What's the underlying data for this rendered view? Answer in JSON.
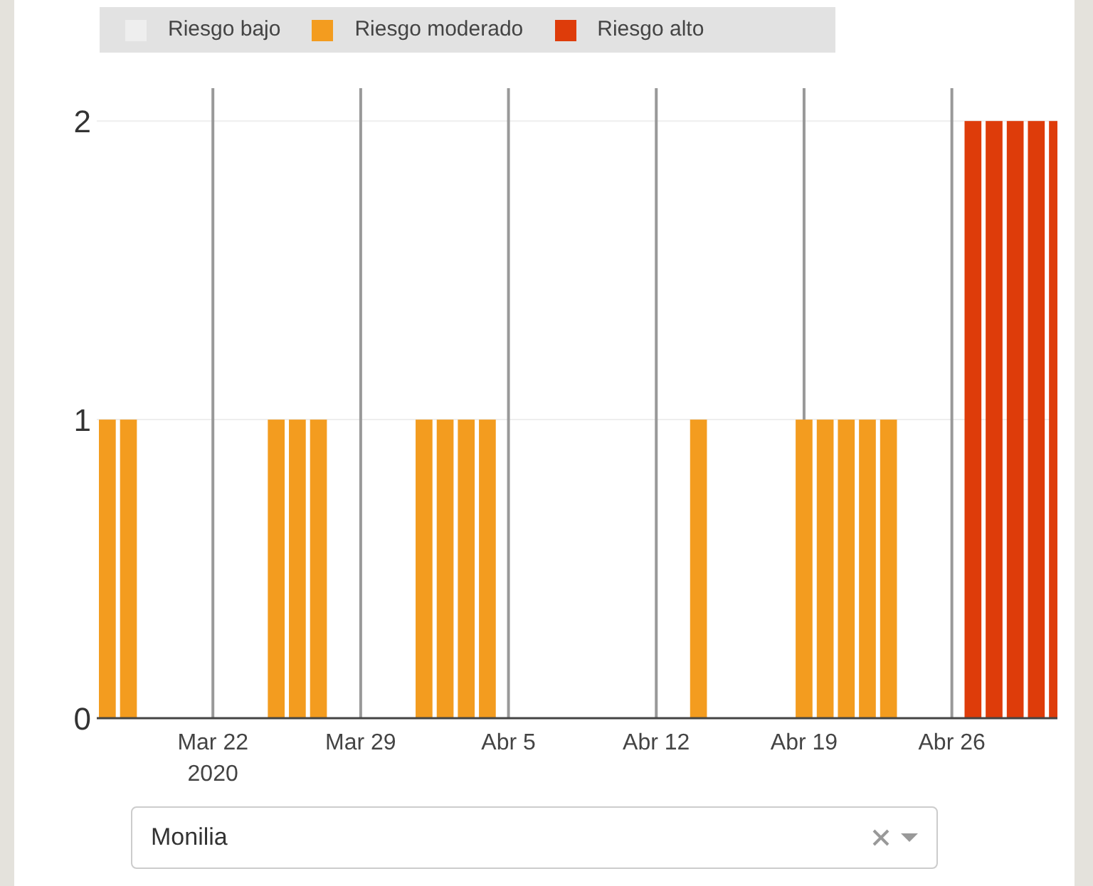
{
  "chart_data": {
    "type": "bar",
    "stacked": true,
    "grid": true,
    "xlim": [
      "2020-03-16T12:00",
      "2020-05-01"
    ],
    "x": [
      "2020-03-17",
      "2020-03-18",
      "2020-03-19",
      "2020-03-20",
      "2020-03-21",
      "2020-03-22",
      "2020-03-23",
      "2020-03-24",
      "2020-03-25",
      "2020-03-26",
      "2020-03-27",
      "2020-03-28",
      "2020-03-29",
      "2020-03-30",
      "2020-03-31",
      "2020-04-01",
      "2020-04-02",
      "2020-04-03",
      "2020-04-04",
      "2020-04-05",
      "2020-04-06",
      "2020-04-07",
      "2020-04-08",
      "2020-04-09",
      "2020-04-10",
      "2020-04-11",
      "2020-04-12",
      "2020-04-13",
      "2020-04-14",
      "2020-04-15",
      "2020-04-16",
      "2020-04-17",
      "2020-04-18",
      "2020-04-19",
      "2020-04-20",
      "2020-04-21",
      "2020-04-22",
      "2020-04-23",
      "2020-04-24",
      "2020-04-25",
      "2020-04-26",
      "2020-04-27",
      "2020-04-28",
      "2020-04-29",
      "2020-04-30",
      "2020-05-01"
    ],
    "series": [
      {
        "name": "Riesgo bajo",
        "color": "#eeeeee",
        "values": [
          0,
          0,
          0,
          0,
          0,
          0,
          0,
          0,
          0,
          0,
          0,
          0,
          0,
          0,
          0,
          0,
          0,
          0,
          0,
          0,
          0,
          0,
          0,
          0,
          0,
          0,
          0,
          0,
          0,
          0,
          0,
          0,
          0,
          0,
          0,
          0,
          0,
          0,
          0,
          0,
          0,
          0,
          0,
          0,
          0,
          0
        ]
      },
      {
        "name": "Riesgo moderado",
        "color": "#f39c1f",
        "values": [
          1,
          1,
          0,
          0,
          0,
          0,
          0,
          0,
          1,
          1,
          1,
          0,
          0,
          0,
          0,
          1,
          1,
          1,
          1,
          0,
          0,
          0,
          0,
          0,
          0,
          0,
          0,
          0,
          1,
          0,
          0,
          0,
          0,
          1,
          1,
          1,
          1,
          1,
          0,
          0,
          0,
          0,
          0,
          0,
          0,
          0
        ]
      },
      {
        "name": "Riesgo alto",
        "color": "#de3c0a",
        "values": [
          0,
          0,
          0,
          0,
          0,
          0,
          0,
          0,
          0,
          0,
          0,
          0,
          0,
          0,
          0,
          0,
          0,
          0,
          0,
          0,
          0,
          0,
          0,
          0,
          0,
          0,
          0,
          0,
          0,
          0,
          0,
          0,
          0,
          0,
          0,
          0,
          0,
          0,
          0,
          0,
          0,
          2,
          2,
          2,
          2,
          2
        ]
      }
    ],
    "ylim": [
      0,
      2.11
    ],
    "yticks": [
      0,
      1,
      2
    ],
    "xticks": [
      {
        "value": "2020-03-22",
        "label": "Mar 22\n2020"
      },
      {
        "value": "2020-03-29",
        "label": "Mar 29"
      },
      {
        "value": "2020-04-05",
        "label": "Abr 5"
      },
      {
        "value": "2020-04-12",
        "label": "Abr 12"
      },
      {
        "value": "2020-04-19",
        "label": "Abr 19"
      },
      {
        "value": "2020-04-26",
        "label": "Abr 26"
      }
    ]
  },
  "dropdown": {
    "value": "Monilia"
  }
}
